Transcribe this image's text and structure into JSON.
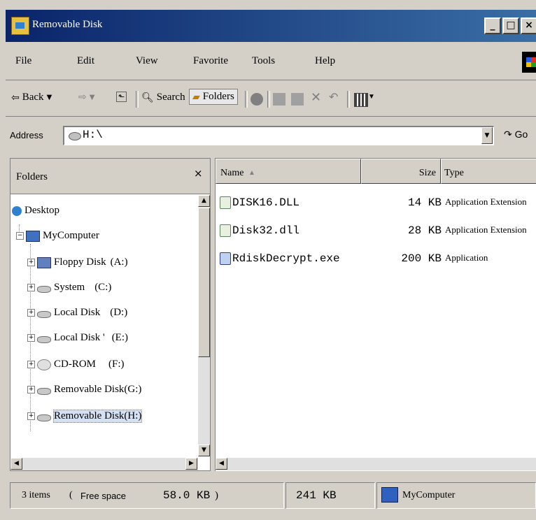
{
  "window": {
    "title": "Removable Disk",
    "buttons": {
      "minimize": "_",
      "maximize": "□",
      "close": "×"
    }
  },
  "menu": [
    "File",
    "Edit",
    "View",
    "Favorite",
    "Tools",
    "Help"
  ],
  "toolbar": {
    "back_label": "Back",
    "search_label": "Search",
    "folders_label": "Folders"
  },
  "address": {
    "label": "Address",
    "value": "H:\\",
    "go_label": "Go"
  },
  "folders_pane": {
    "title": "Folders",
    "close_label": "×",
    "tree": [
      {
        "label": "Desktop",
        "icon": "desktop-icon"
      },
      {
        "label": "MyComputer",
        "icon": "computer-icon"
      },
      {
        "label": "Floppy Disk",
        "drive": "(A:)",
        "icon": "floppy-drive-icon"
      },
      {
        "label": "System",
        "drive": "(C:)",
        "icon": "hard-drive-icon"
      },
      {
        "label": "Local Disk",
        "drive": "(D:)",
        "icon": "hard-drive-icon"
      },
      {
        "label": "Local Disk '",
        "drive": "(E:)",
        "icon": "hard-drive-icon"
      },
      {
        "label": "CD-ROM",
        "drive": "(F:)",
        "icon": "cd-drive-icon"
      },
      {
        "label": "Removable Disk",
        "drive": "(G:)",
        "icon": "removable-drive-icon"
      },
      {
        "label": "Removable Disk",
        "drive": "(H:)",
        "icon": "removable-drive-icon",
        "selected": true
      }
    ]
  },
  "file_list": {
    "columns": {
      "name": "Name",
      "size": "Size",
      "type": "Type"
    },
    "files": [
      {
        "name": "DISK16.DLL",
        "size": "14 KB",
        "type": "Application Extension"
      },
      {
        "name": "Disk32.dll",
        "size": "28 KB",
        "type": "Application Extension"
      },
      {
        "name": "RdiskDecrypt.exe",
        "size": "200 KB",
        "type": "Application"
      }
    ]
  },
  "status": {
    "items": "3 items",
    "free_space_label": "Free space",
    "free_space_value": "58.0 KB",
    "total_size": "241 KB",
    "location": "MyComputer"
  },
  "colors": {
    "titlebar_start": "#0a246a",
    "titlebar_end": "#3a6ea5",
    "chrome": "#d4d0c8"
  }
}
